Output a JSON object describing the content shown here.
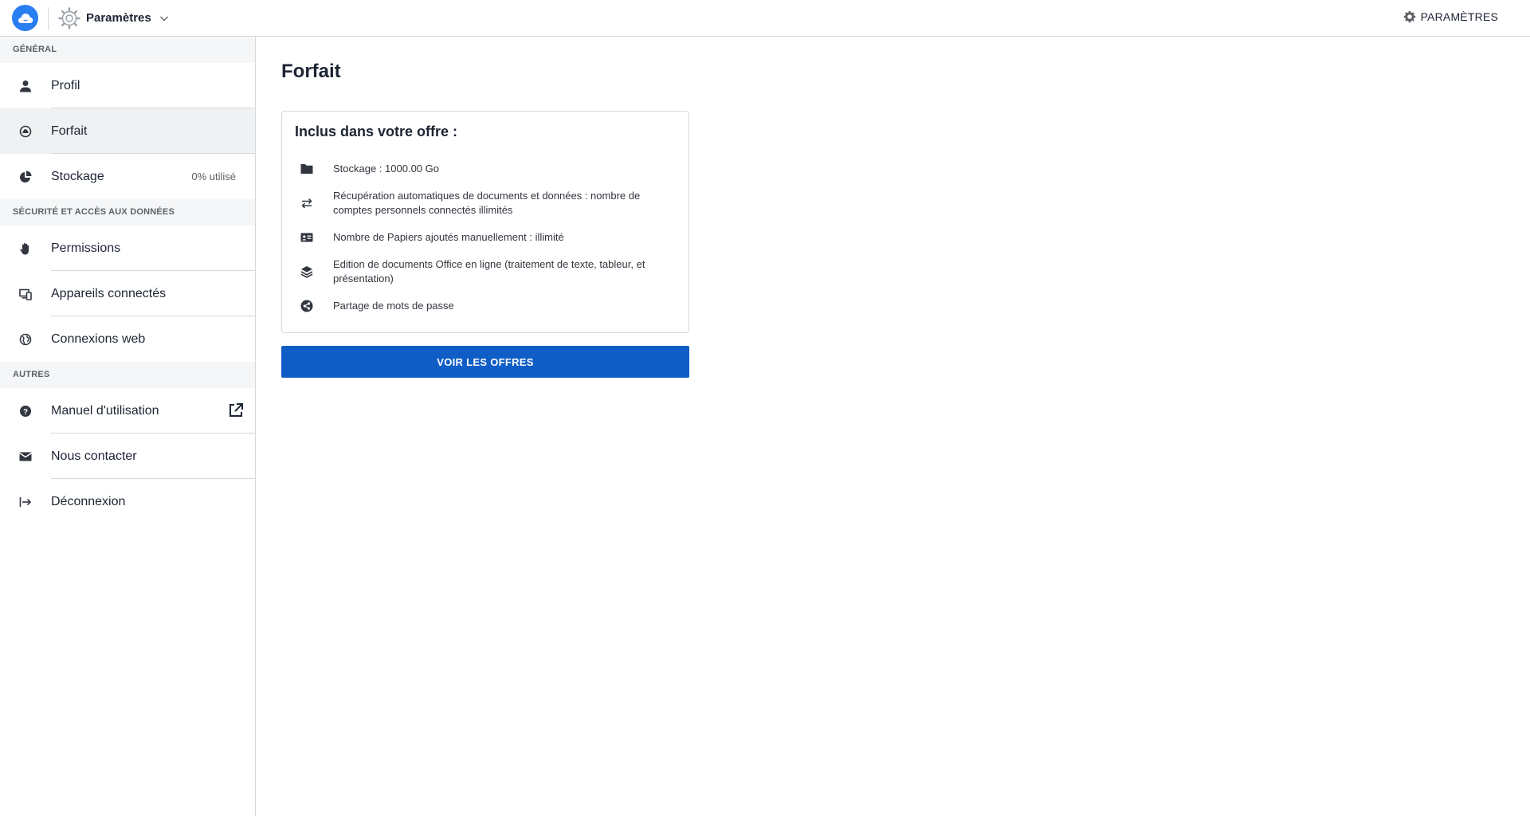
{
  "topbar": {
    "app_name": "Paramètres",
    "right_label": "PARAMÈTRES",
    "icons": {
      "logo": "cloud-logo-icon",
      "app": "settings-gear-icon",
      "chevron": "chevron-down-icon",
      "right": "gear-icon"
    }
  },
  "sidebar": {
    "sections": [
      {
        "title": "GÉNÉRAL"
      },
      {
        "title": "SÉCURITÉ ET ACCÈS AUX DONNÉES"
      },
      {
        "title": "AUTRES"
      }
    ],
    "items": [
      {
        "label": "Profil",
        "icon": "person-icon"
      },
      {
        "label": "Forfait",
        "icon": "plan-icon",
        "active": true
      },
      {
        "label": "Stockage",
        "icon": "pie-chart-icon",
        "extra": "0% utilisé"
      },
      {
        "label": "Permissions",
        "icon": "hand-icon"
      },
      {
        "label": "Appareils connectés",
        "icon": "devices-icon"
      },
      {
        "label": "Connexions web",
        "icon": "globe-icon"
      },
      {
        "label": "Manuel d'utilisation",
        "icon": "help-icon"
      },
      {
        "label": "Nous contacter",
        "icon": "mail-icon"
      },
      {
        "label": "Déconnexion",
        "icon": "logout-icon"
      }
    ]
  },
  "main": {
    "title": "Forfait",
    "card": {
      "title": "Inclus dans votre offre :",
      "features": [
        {
          "text": "Stockage : 1000.00 Go",
          "icon": "folder-icon"
        },
        {
          "text": "Récupération automatiques de documents et données : nombre de comptes personnels connectés illimités",
          "icon": "sync-icon"
        },
        {
          "text": "Nombre de Papiers ajoutés manuellement : illimité",
          "icon": "id-card-icon"
        },
        {
          "text": "Edition de documents Office en ligne (traitement de texte, tableur, et présentation)",
          "icon": "layers-icon"
        },
        {
          "text": "Partage de mots de passe",
          "icon": "share-icon"
        }
      ]
    },
    "cta": "VOIR LES OFFRES"
  },
  "colors": {
    "accent": "#0f5ec7",
    "logo": "#297ef2",
    "text": "#1d2433",
    "muted": "#5d6165",
    "border": "#d6d8da"
  }
}
